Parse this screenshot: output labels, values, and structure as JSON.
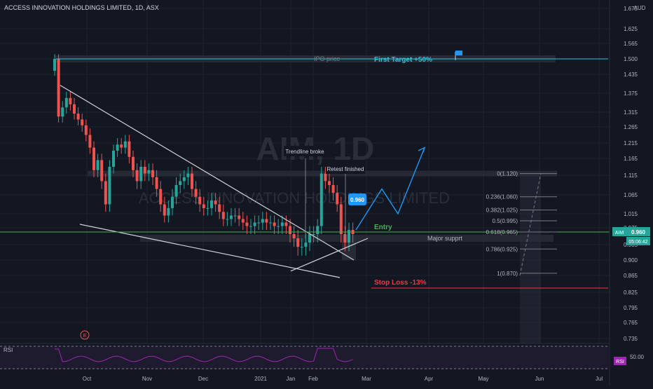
{
  "header": {
    "symbol_title": "ACCESS INNOVATION HOLDINGS LIMITED, 1D, ASX"
  },
  "watermark": {
    "ticker": "AIM, 1D",
    "company": "ACCESS INNOVATION HOLDINGS LIMITED"
  },
  "currency_label": "AUD",
  "last_price": {
    "ticker": "AIM",
    "price": "0.960",
    "countdown": "05:06:42"
  },
  "colors": {
    "up": "#26a69a",
    "down": "#ef5350",
    "background": "#131722",
    "grid": "#1f2330",
    "target": "#26c6da",
    "stop": "#f23645",
    "entry": "#4caf50",
    "forecast": "#2196f3",
    "rsi": "#9c27b0"
  },
  "annotations": {
    "ipo_price": "IPO price",
    "first_target": "First Target +50%",
    "trendline_broke": "Trendline broke",
    "retest_finished": "Retest finished",
    "price_tag": "0.960",
    "entry": "Entry",
    "major_support": "Major supprt",
    "stop_loss": "Stop Loss -13%"
  },
  "fib_levels": [
    {
      "label": "0(1.120)",
      "price": 1.12
    },
    {
      "label": "0.236(1.060)",
      "price": 1.06
    },
    {
      "label": "0.382(1.025)",
      "price": 1.025
    },
    {
      "label": "0.5(0.995)",
      "price": 0.995
    },
    {
      "label": "0.618(0.965)",
      "price": 0.965
    },
    {
      "label": "0.786(0.925)",
      "price": 0.925
    },
    {
      "label": "1(0.870)",
      "price": 0.87
    }
  ],
  "rsi": {
    "label": "RSI",
    "value_tag": "RSI",
    "level_label": "50.00"
  },
  "event_marker": "E",
  "chart_data": {
    "type": "candlestick",
    "title": "ACCESS INNOVATION HOLDINGS LIMITED, 1D, ASX",
    "y_ticks": [
      "1.675",
      "1.625",
      "1.565",
      "1.500",
      "1.435",
      "1.375",
      "1.315",
      "1.265",
      "1.215",
      "1.165",
      "1.115",
      "1.065",
      "1.015",
      "0.975",
      "0.935",
      "0.900",
      "0.865",
      "0.825",
      "0.795",
      "0.765",
      "0.735"
    ],
    "x_ticks": [
      "Oct",
      "Nov",
      "Dec",
      "2021",
      "Jan",
      "Feb",
      "Mar",
      "Apr",
      "May",
      "Jun",
      "Jul"
    ],
    "series": [
      {
        "name": "AIM",
        "closes": [
          1.5,
          1.3,
          1.33,
          1.36,
          1.34,
          1.31,
          1.29,
          1.27,
          1.24,
          1.2,
          1.13,
          1.16,
          1.1,
          1.04,
          1.14,
          1.19,
          1.21,
          1.2,
          1.22,
          1.17,
          1.13,
          1.1,
          1.14,
          1.12,
          1.13,
          1.11,
          1.08,
          1.04,
          1.01,
          1.03,
          1.06,
          1.09,
          1.1,
          1.11,
          1.12,
          1.08,
          1.06,
          1.04,
          1.03,
          1.03,
          1.05,
          1.04,
          1.02,
          1.0,
          1.0,
          1.01,
          1.01,
          1.0,
          0.99,
          0.98,
          0.98,
          0.99,
          0.99,
          1.0,
          0.99,
          0.99,
          0.98,
          0.98,
          0.99,
          0.98,
          0.96,
          0.95,
          0.93,
          0.93,
          0.94,
          0.96,
          0.96,
          0.98,
          1.12,
          1.1,
          1.09,
          1.07,
          1.04,
          0.96,
          0.94,
          0.97,
          0.96
        ]
      }
    ]
  }
}
